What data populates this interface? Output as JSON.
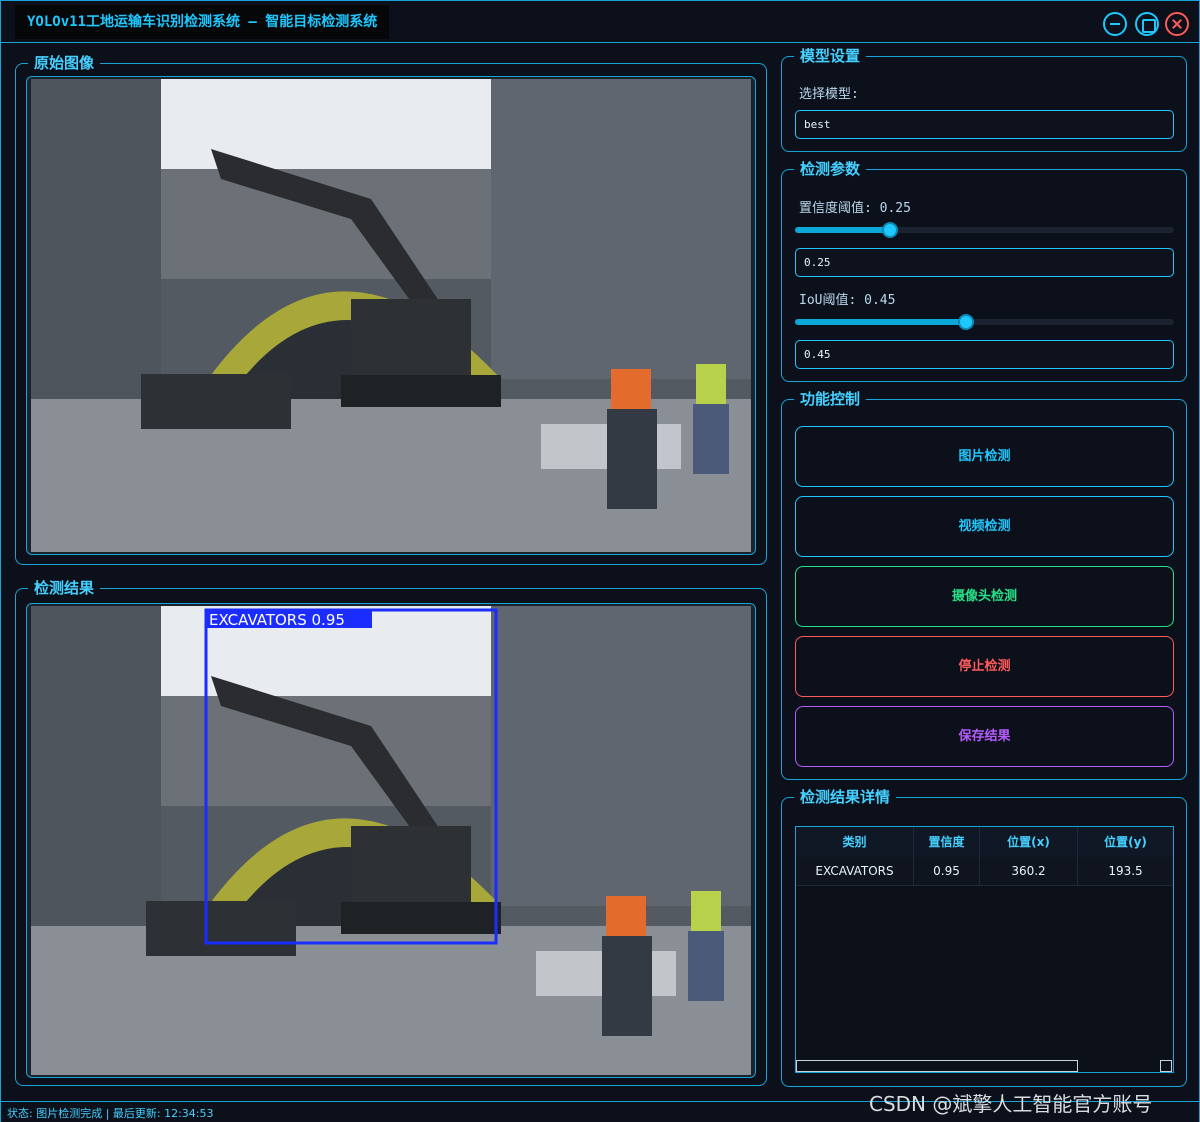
{
  "window": {
    "title": "YOLOv11工地运输车识别检测系统 – 智能目标检测系统"
  },
  "panels": {
    "original_title": "原始图像",
    "result_title": "检测结果",
    "model_title": "模型设置",
    "params_title": "检测参数",
    "control_title": "功能控制",
    "details_title": "检测结果详情"
  },
  "model": {
    "select_label": "选择模型:",
    "selected": "best"
  },
  "params": {
    "conf_label": "置信度阈值: 0.25",
    "conf_value": "0.25",
    "conf_level": 0.25,
    "iou_label": "IoU阈值: 0.45",
    "iou_value": "0.45",
    "iou_level": 0.45
  },
  "buttons": {
    "image_detect": "图片检测",
    "video_detect": "视频检测",
    "camera_detect": "摄像头检测",
    "stop_detect": "停止检测",
    "save_result": "保存结果"
  },
  "button_colors": {
    "image_detect": "#1ec8ff",
    "video_detect": "#1ec8ff",
    "camera_detect": "#27e08a",
    "stop_detect": "#ff5a5a",
    "save_result": "#b65cff"
  },
  "detection": {
    "label": "EXCAVATORS 0.95",
    "box_color": "#1a2cff"
  },
  "table": {
    "headers": [
      "类别",
      "置信度",
      "位置(x)",
      "位置(y)"
    ],
    "rows": [
      [
        "EXCAVATORS",
        "0.95",
        "360.2",
        "193.5"
      ]
    ]
  },
  "status": {
    "text": "状态: 图片检测完成 | 最后更新: 12:34:53"
  },
  "watermark": "CSDN @斌擎人工智能官方账号",
  "icons": {
    "minimize": "minimize-icon",
    "maximize": "maximize-icon",
    "close": "close-icon"
  }
}
